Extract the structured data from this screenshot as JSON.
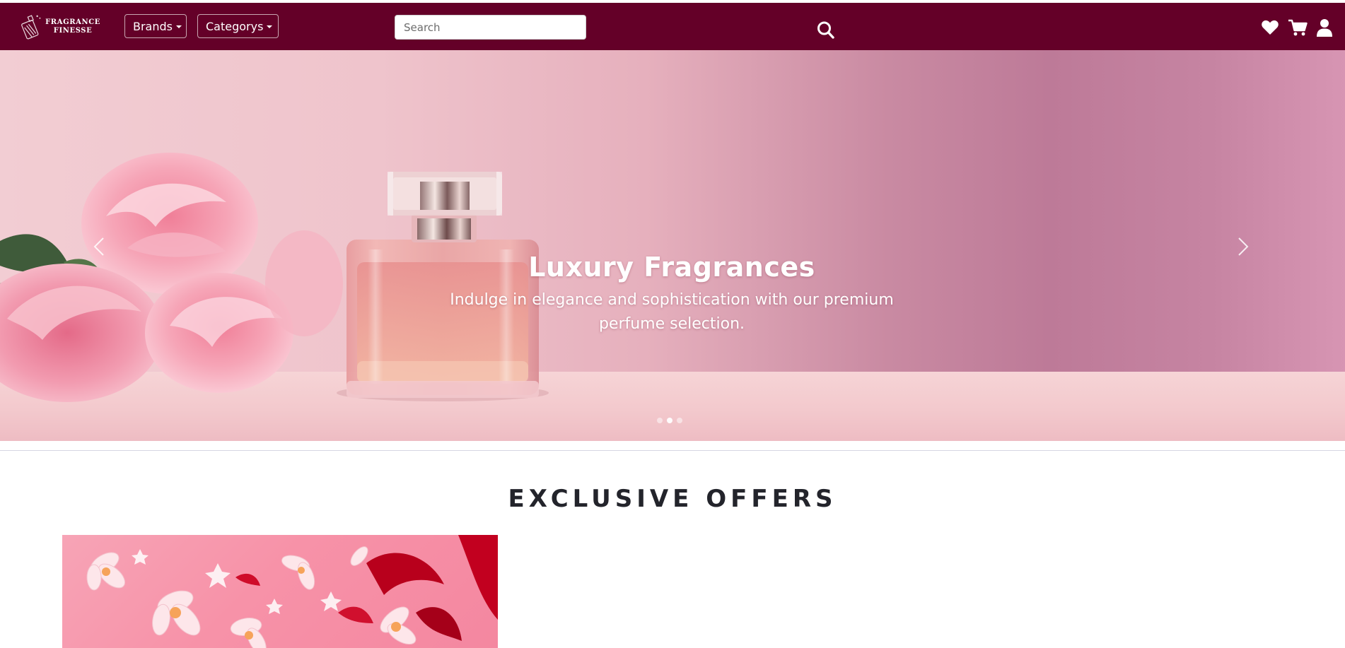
{
  "brand": {
    "logo_line1": "FRAGRANCE",
    "logo_line2": "FINESSE"
  },
  "nav": {
    "brands_label": "Brands",
    "categories_label": "Categorys",
    "search_placeholder": "Search",
    "search_value": "",
    "icons": [
      "search-icon",
      "heart-icon",
      "cart-icon",
      "user-icon"
    ]
  },
  "hero": {
    "title": "Luxury Fragrances",
    "subtitle": "Indulge in elegance and sophistication with our premium perfume selection.",
    "slide_count": 3,
    "active_slide": 2
  },
  "offers": {
    "title": "EXCLUSIVE OFFERS"
  },
  "colors": {
    "navbar": "#640028",
    "hero_pink": "#efc4cc",
    "offer_pink": "#f792a8"
  }
}
